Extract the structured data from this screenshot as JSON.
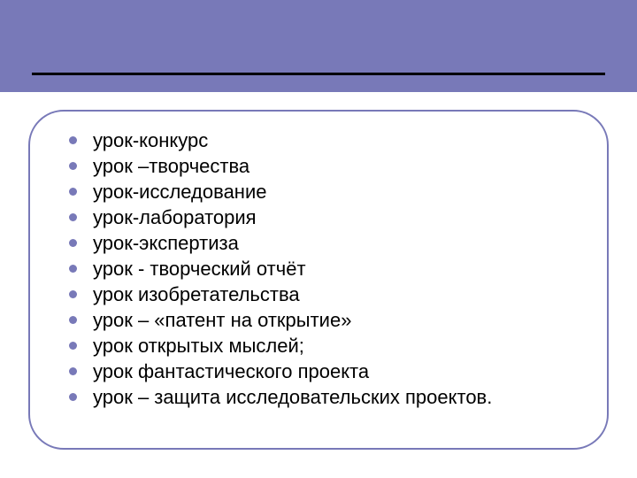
{
  "colors": {
    "accent": "#7879b8"
  },
  "items": [
    "урок-конкурс",
    "урок –творчества",
    "урок-исследование",
    "урок-лаборатория",
    "урок-экспертиза",
    "урок - творческий отчёт",
    "урок изобретательства",
    "урок – «патент на открытие»",
    "урок открытых мыслей;",
    "урок фантастического проекта",
    "урок – защита исследовательских проектов."
  ]
}
